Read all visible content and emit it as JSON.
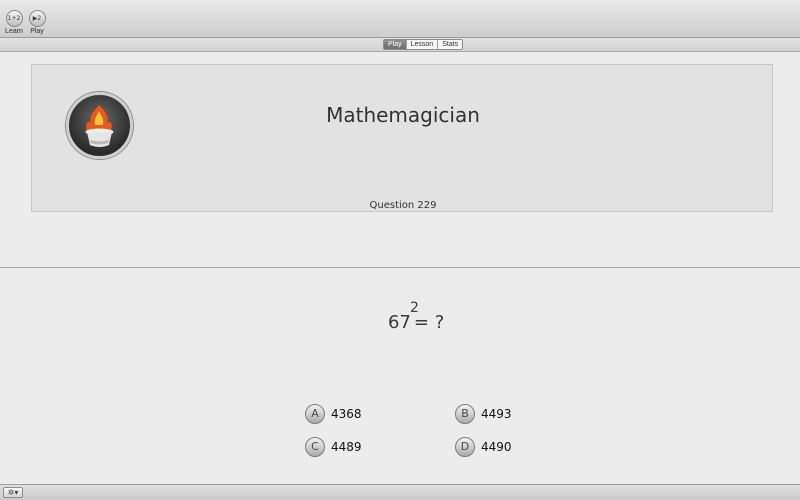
{
  "toolbar": {
    "learn": {
      "label": "Learn",
      "icon": "learn-icon",
      "glyph": "1+2"
    },
    "play": {
      "label": "Play",
      "icon": "play-icon",
      "glyph": "▶2"
    }
  },
  "tabs": [
    {
      "label": "Play",
      "selected": true
    },
    {
      "label": "Lesson",
      "selected": false
    },
    {
      "label": "Stats",
      "selected": false
    }
  ],
  "header": {
    "title": "Mathemagician",
    "question_label": "Question  229",
    "logo_icon": "magic-hat-fire-icon"
  },
  "problem": {
    "base": "67",
    "exponent": "2",
    "rest": "= ?"
  },
  "answers": [
    {
      "letter": "A",
      "value": "4368"
    },
    {
      "letter": "B",
      "value": "4493"
    },
    {
      "letter": "C",
      "value": "4489"
    },
    {
      "letter": "D",
      "value": "4490"
    }
  ],
  "bottom": {
    "gear_icon": "gear-icon",
    "gear_glyph": "✲▾"
  },
  "colors": {
    "window_bg": "#ececec",
    "panel_bg": "#e2e2e2",
    "selected_tab": "#7a7a7a"
  }
}
